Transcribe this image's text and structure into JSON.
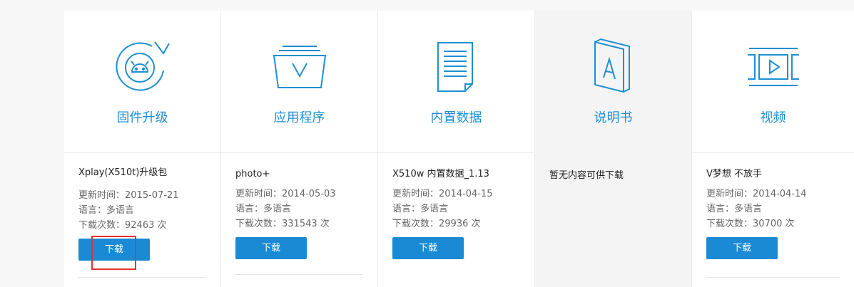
{
  "accent_color": "#1e8fd3",
  "button_color": "#1a8ad4",
  "columns": [
    {
      "icon": "firmware-upgrade-icon",
      "category": "固件升级",
      "title": "Xplay(X510t)升级包",
      "update_time": "更新时间：2015-07-21",
      "language": "语言：多语言",
      "downloads": "下载次数：92463 次",
      "button": "下载"
    },
    {
      "icon": "app-folder-icon",
      "category": "应用程序",
      "title": "photo+",
      "update_time": "更新时间：2014-05-03",
      "language": "语言：多语言",
      "downloads": "下载次数：331543 次",
      "button": "下载"
    },
    {
      "icon": "document-icon",
      "category": "内置数据",
      "title": "X510w 内置数据_1.13",
      "update_time": "更新时间：2014-04-15",
      "language": "语言：多语言",
      "downloads": "下载次数：29936 次",
      "button": "下载"
    },
    {
      "icon": "manual-book-icon",
      "category": "说明书",
      "empty_message": "暂无内容可供下载"
    },
    {
      "icon": "video-film-icon",
      "category": "视频",
      "title": "V梦想 不放手",
      "update_time": "更新时间：2014-04-14",
      "language": "语言：多语言",
      "downloads": "下载次数：30700 次",
      "button": "下载"
    }
  ]
}
